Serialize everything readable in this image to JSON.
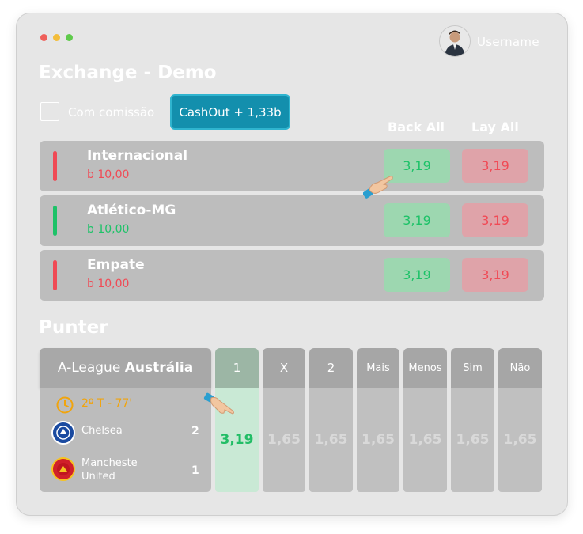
{
  "window": {
    "username": "Username",
    "title": "Exchange - Demo"
  },
  "controls": {
    "commission_label": "Com comissão",
    "cashout_label": "CashOut + 1,33b"
  },
  "columns": {
    "back_all": "Back All",
    "lay_all": "Lay All"
  },
  "runners": [
    {
      "name": "Internacional",
      "pl": "b 10,00",
      "pl_color": "#f04a55",
      "bar_color": "#f04a55",
      "back": "3,19",
      "lay": "3,19"
    },
    {
      "name": "Atlético-MG",
      "pl": "b 10,00",
      "pl_color": "#1dc268",
      "bar_color": "#1dc268",
      "back": "3,19",
      "lay": "3,19"
    },
    {
      "name": "Empate",
      "pl": "b 10,00",
      "pl_color": "#f04a55",
      "bar_color": "#f04a55",
      "back": "3,19",
      "lay": "3,19"
    }
  ],
  "punter": {
    "title": "Punter",
    "league_prefix": "A-League",
    "league_name": "Austrália",
    "time": "2º T - 77'",
    "home_team": "Chelsea",
    "home_score": "2",
    "away_team_line1": "Mancheste",
    "away_team_line2": "United",
    "away_score": "1",
    "markets": [
      {
        "label": "1",
        "odd": "3,19"
      },
      {
        "label": "X",
        "odd": "1,65"
      },
      {
        "label": "2",
        "odd": "1,65"
      },
      {
        "label": "Mais",
        "odd": "1,65"
      },
      {
        "label": "Menos",
        "odd": "1,65"
      },
      {
        "label": "Sim",
        "odd": "1,65"
      },
      {
        "label": "Não",
        "odd": "1,65"
      }
    ]
  },
  "colors": {
    "back": "#1dc268",
    "lay": "#f04a55",
    "cashout": "#138fad",
    "clock": "#f1a40c"
  }
}
